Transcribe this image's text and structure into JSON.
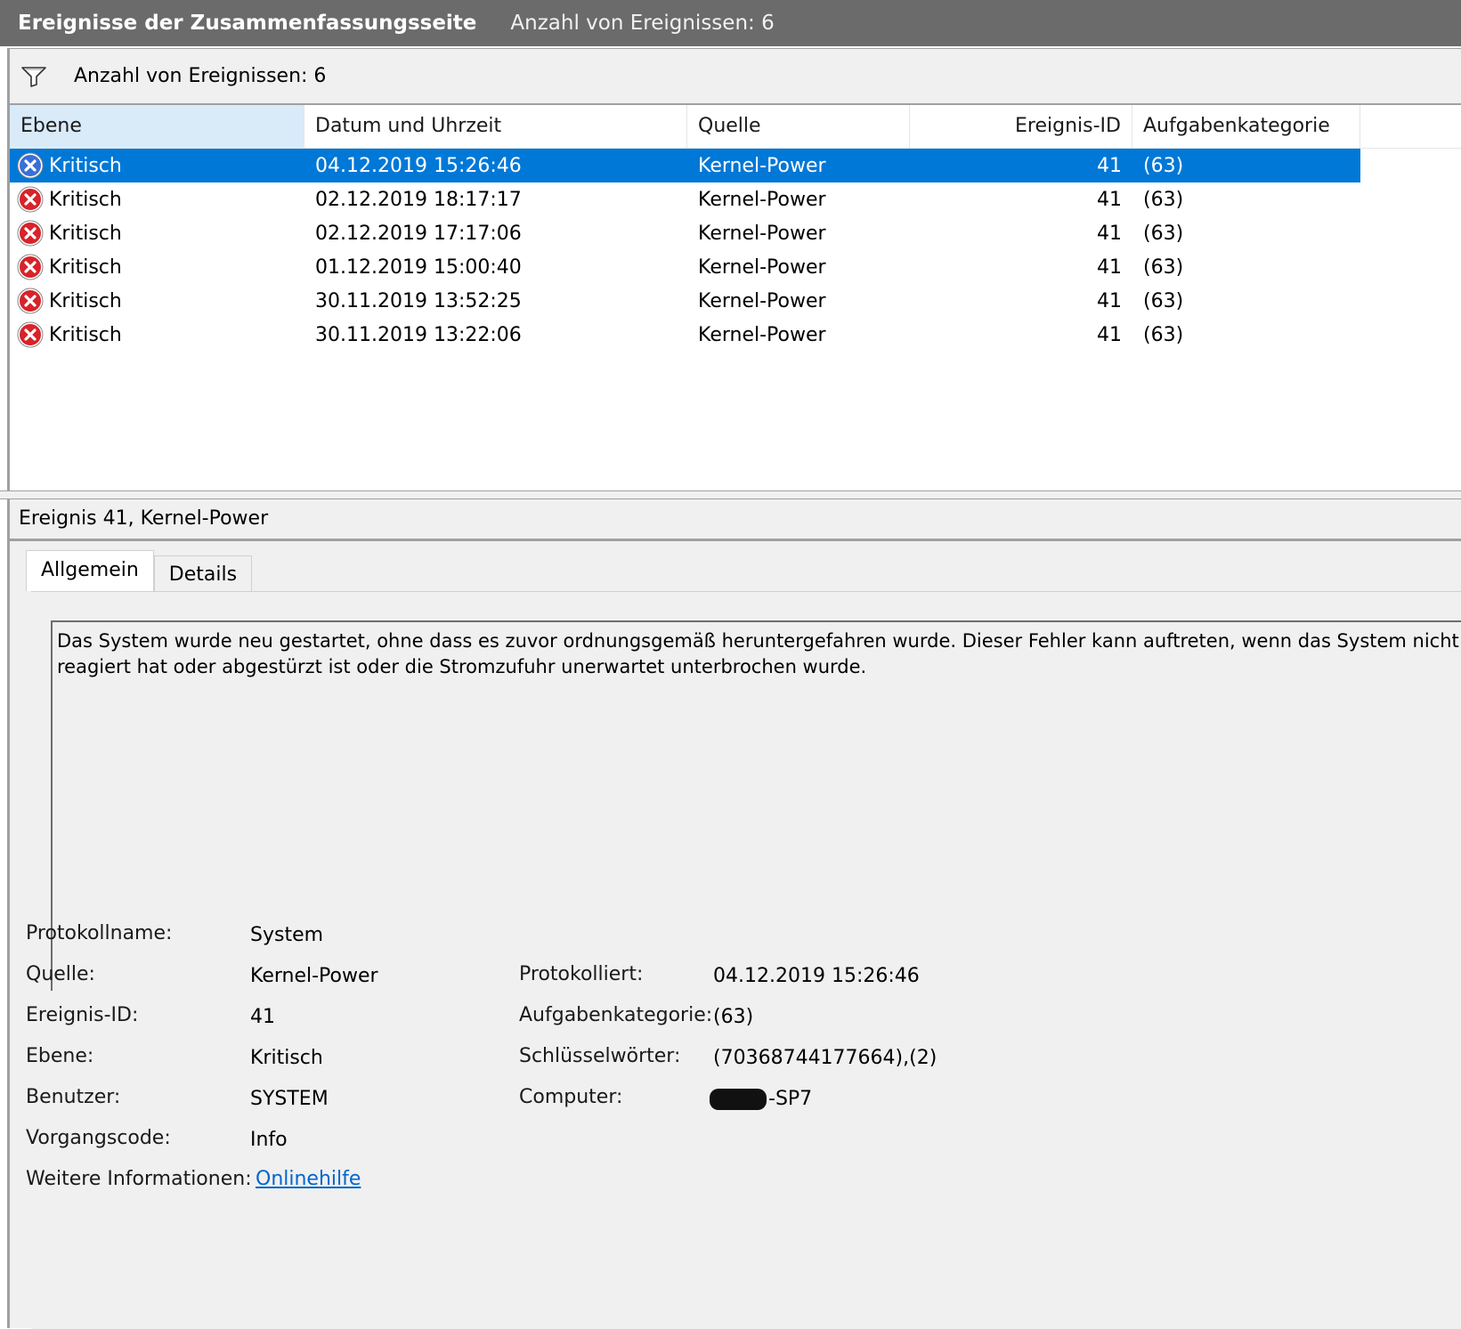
{
  "title_bar": {
    "title": "Ereignisse der Zusammenfassungsseite",
    "count_text": "Anzahl von Ereignissen: 6"
  },
  "filter_bar": {
    "icon": "filter-icon",
    "text": "Anzahl von Ereignissen: 6"
  },
  "table": {
    "columns": [
      "Ebene",
      "Datum und Uhrzeit",
      "Quelle",
      "Ereignis-ID",
      "Aufgabenkategorie"
    ],
    "sorted_column": "Ebene",
    "rows": [
      {
        "level": "Kritisch",
        "datetime": "04.12.2019 15:26:46",
        "source": "Kernel-Power",
        "event_id": "41",
        "category": "(63)",
        "selected": true
      },
      {
        "level": "Kritisch",
        "datetime": "02.12.2019 18:17:17",
        "source": "Kernel-Power",
        "event_id": "41",
        "category": "(63)"
      },
      {
        "level": "Kritisch",
        "datetime": "02.12.2019 17:17:06",
        "source": "Kernel-Power",
        "event_id": "41",
        "category": "(63)"
      },
      {
        "level": "Kritisch",
        "datetime": "01.12.2019 15:00:40",
        "source": "Kernel-Power",
        "event_id": "41",
        "category": "(63)"
      },
      {
        "level": "Kritisch",
        "datetime": "30.11.2019 13:52:25",
        "source": "Kernel-Power",
        "event_id": "41",
        "category": "(63)"
      },
      {
        "level": "Kritisch",
        "datetime": "30.11.2019 13:22:06",
        "source": "Kernel-Power",
        "event_id": "41",
        "category": "(63)"
      }
    ],
    "selected_color": "#0078d7",
    "critical_icon": "critical-error-icon"
  },
  "detail": {
    "header": "Ereignis 41, Kernel-Power",
    "tabs": [
      "Allgemein",
      "Details"
    ],
    "active_tab": "Allgemein",
    "description_line1": "Das System wurde neu gestartet, ohne dass es zuvor ordnungsgemäß heruntergefahren wurde. Dieser Fehler kann auftreten, wenn das System nicht m",
    "description_line2": "reagiert hat oder abgestürzt ist oder die Stromzufuhr unerwartet unterbrochen wurde.",
    "props": {
      "log_name_label": "Protokollname:",
      "log_name": "System",
      "source_label": "Quelle:",
      "source": "Kernel-Power",
      "event_id_label": "Ereignis-ID:",
      "event_id": "41",
      "level_label": "Ebene:",
      "level": "Kritisch",
      "user_label": "Benutzer:",
      "user": "SYSTEM",
      "opcode_label": "Vorgangscode:",
      "opcode": "Info",
      "more_info_label": "Weitere Informationen:",
      "more_info_link": "Onlinehilfe",
      "logged_label": "Protokolliert:",
      "logged": "04.12.2019 15:26:46",
      "task_category_label": "Aufgabenkategorie:",
      "task_category": "(63)",
      "keywords_label": "Schlüsselwörter:",
      "keywords": "(70368744177664),(2)",
      "computer_label": "Computer:",
      "computer_visible": "-SP7"
    }
  }
}
